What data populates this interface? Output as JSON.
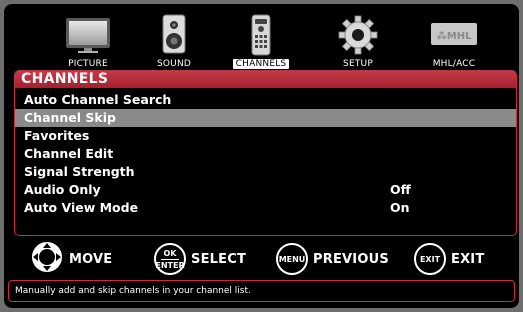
{
  "tabs": [
    {
      "label": "PICTURE",
      "icon": "tv-screen-icon"
    },
    {
      "label": "SOUND",
      "icon": "speaker-icon"
    },
    {
      "label": "CHANNELS",
      "icon": "remote-control-icon",
      "active": true
    },
    {
      "label": "SETUP",
      "icon": "gear-icon"
    },
    {
      "label": "MHL/ACC",
      "icon": "mhl-logo-icon",
      "logo_text": "MHL"
    }
  ],
  "panel": {
    "title": "CHANNELS",
    "items": [
      {
        "label": "Auto Channel Search",
        "value": ""
      },
      {
        "label": "Channel Skip",
        "value": "",
        "selected": true
      },
      {
        "label": "Favorites",
        "value": ""
      },
      {
        "label": "Channel Edit",
        "value": ""
      },
      {
        "label": "Signal Strength",
        "value": ""
      },
      {
        "label": "Audio Only",
        "value": "Off"
      },
      {
        "label": "Auto View Mode",
        "value": "On"
      }
    ]
  },
  "controls": {
    "move": {
      "label": "MOVE",
      "icon": "dpad-icon"
    },
    "select": {
      "label": "SELECT",
      "button_top": "OK",
      "button_bottom": "ENTER"
    },
    "previous": {
      "label": "PREVIOUS",
      "button": "MENU"
    },
    "exit": {
      "label": "EXIT",
      "button": "EXIT"
    }
  },
  "help_text": "Manually add and skip channels in your channel list.",
  "colors": {
    "accent": "#b52a38",
    "selected_row": "#8a8a8a",
    "background": "#000000"
  }
}
